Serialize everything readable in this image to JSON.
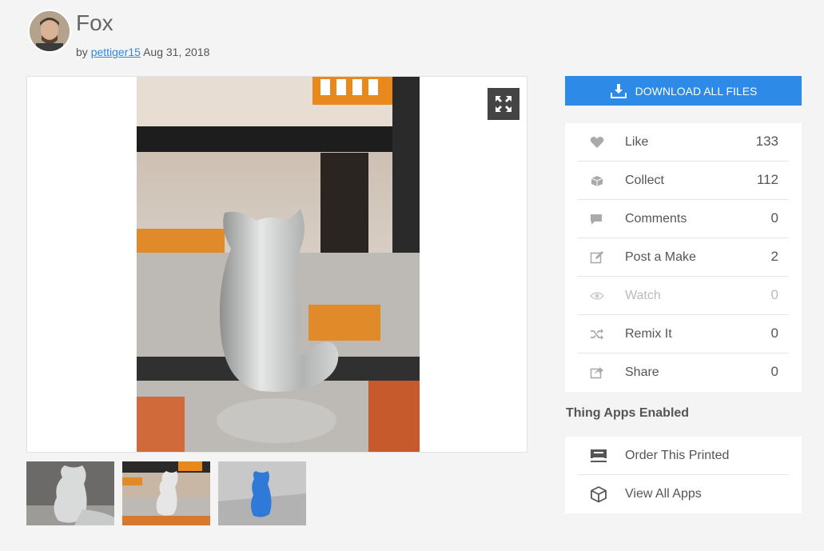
{
  "header": {
    "title": "Fox",
    "by_prefix": "by",
    "author": "pettiger15",
    "date": "Aug 31, 2018"
  },
  "viewer": {
    "expand_icon": "expand-arrows-icon"
  },
  "thumbnails": [
    {
      "name": "thumbnail-1",
      "desc_color": "#cfd0d0"
    },
    {
      "name": "thumbnail-2",
      "desc_color": "#b8aa9a"
    },
    {
      "name": "thumbnail-3",
      "desc_color": "#2f7ad8"
    }
  ],
  "download": {
    "label": "DOWNLOAD ALL FILES",
    "icon": "download-icon"
  },
  "actions": [
    {
      "key": "like",
      "label": "Like",
      "count": "133",
      "icon": "heart-icon"
    },
    {
      "key": "collect",
      "label": "Collect",
      "count": "112",
      "icon": "collect-icon"
    },
    {
      "key": "comments",
      "label": "Comments",
      "count": "0",
      "icon": "comment-icon"
    },
    {
      "key": "make",
      "label": "Post a Make",
      "count": "2",
      "icon": "edit-icon"
    },
    {
      "key": "watch",
      "label": "Watch",
      "count": "0",
      "icon": "eye-icon"
    },
    {
      "key": "remix",
      "label": "Remix It",
      "count": "0",
      "icon": "shuffle-icon"
    },
    {
      "key": "share",
      "label": "Share",
      "count": "0",
      "icon": "share-icon"
    }
  ],
  "apps": {
    "heading": "Thing Apps Enabled",
    "items": [
      {
        "label": "Order This Printed",
        "icon": "printer-icon"
      },
      {
        "label": "View All Apps",
        "icon": "cube-icon"
      }
    ]
  },
  "colors": {
    "accent": "#2d8ae6",
    "background": "#f4f4f4"
  }
}
